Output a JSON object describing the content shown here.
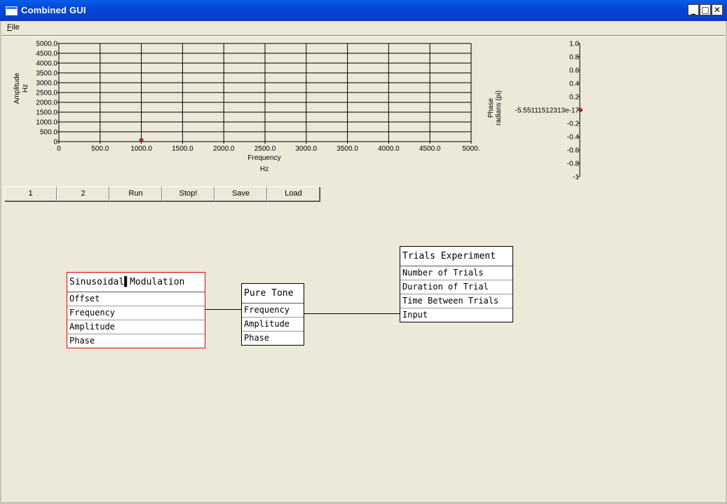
{
  "window": {
    "title": "Combined GUI",
    "minimize_glyph": "_",
    "maximize_glyph": "□",
    "close_glyph": "✕"
  },
  "menu": {
    "file_label": "File",
    "file_mnemonic": "F",
    "file_rest": "ile"
  },
  "amplitude_plot": {
    "ylabel": "Amplitude",
    "yunit": "Hz",
    "xlabel": "Frequency",
    "xunit": "Hz",
    "xticks": [
      "0",
      "500.0",
      "1000.0",
      "1500.0",
      "2000.0",
      "2500.0",
      "3000.0",
      "3500.0",
      "4000.0",
      "4500.0",
      "5000."
    ],
    "yticks": [
      "0",
      "500.0",
      "1000.0",
      "1500.0",
      "2000.0",
      "2500.0",
      "3000.0",
      "3500.0",
      "4000.0",
      "4500.0",
      "5000.0"
    ]
  },
  "phase_plot": {
    "ylabel": "Phase",
    "yunit": "radians (pi)",
    "yticks": [
      "1.0",
      "0.8",
      "0.6",
      "0.4",
      "0.2",
      "-5.55111512313e-17",
      "-0.2",
      "-0.4",
      "-0.6",
      "-0.8",
      "-1"
    ]
  },
  "chart_data": [
    {
      "type": "scatter",
      "title": "",
      "xlabel": "Frequency",
      "ylabel": "Amplitude",
      "xunit": "Hz",
      "yunit": "Hz",
      "xlim": [
        0,
        5000
      ],
      "ylim": [
        0,
        5000
      ],
      "grid": true,
      "points": [
        {
          "x": 1000,
          "y": 0
        }
      ]
    },
    {
      "type": "scatter",
      "title": "",
      "ylabel": "Phase",
      "yunit": "radians (pi)",
      "ylim": [
        -1,
        1
      ],
      "grid": false,
      "points": [
        {
          "y": -5.55111512313e-17
        }
      ]
    }
  ],
  "toolbar": {
    "buttons": [
      {
        "label": "1"
      },
      {
        "label": "2"
      },
      {
        "label": "Run"
      },
      {
        "label": "Stop!"
      },
      {
        "label": "Save"
      },
      {
        "label": "Load"
      }
    ]
  },
  "nodes": {
    "sinusoidal": {
      "title": "Sinusoidal▌Modulation",
      "fields": [
        "Offset",
        "Frequency",
        "Amplitude",
        "Phase"
      ]
    },
    "pure_tone": {
      "title": "Pure Tone",
      "fields": [
        "Frequency",
        "Amplitude",
        "Phase"
      ]
    },
    "trials": {
      "title": "Trials Experiment",
      "fields": [
        "Number of Trials",
        "Duration of Trial",
        "Time Between Trials",
        "Input"
      ]
    }
  },
  "colors": {
    "titlebar": "#0a4ee0",
    "background": "#ece9d8",
    "marker": "#b03030",
    "selected_border": "#e00000"
  }
}
